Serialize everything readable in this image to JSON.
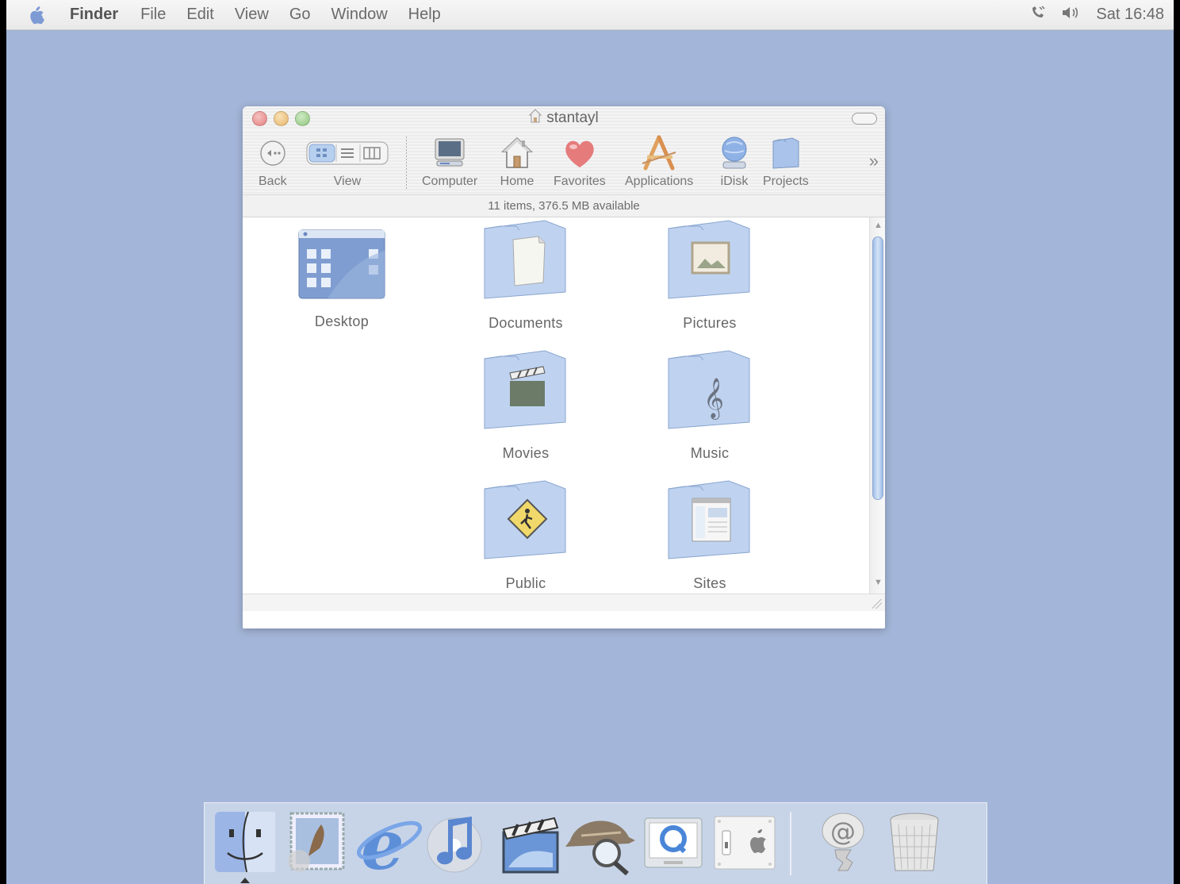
{
  "menubar": {
    "app_name": "Finder",
    "items": [
      "File",
      "Edit",
      "View",
      "Go",
      "Window",
      "Help"
    ],
    "clock": "Sat 16:48"
  },
  "window": {
    "title": "stantayl",
    "status": "11 items, 376.5 MB available",
    "toolbar": {
      "back": "Back",
      "view": "View",
      "computer": "Computer",
      "home": "Home",
      "favorites": "Favorites",
      "applications": "Applications",
      "idisk": "iDisk",
      "projects": "Projects"
    },
    "items": [
      "Desktop",
      "Documents",
      "Pictures",
      "Movies",
      "Music",
      "Public",
      "Sites"
    ]
  },
  "dock": {
    "apps": [
      "finder-icon",
      "mail-icon",
      "internet-explorer-icon",
      "itunes-icon",
      "imovie-icon",
      "sherlock-icon",
      "quicktime-icon",
      "system-preferences-icon",
      "mail-at-icon",
      "trash-icon"
    ]
  }
}
